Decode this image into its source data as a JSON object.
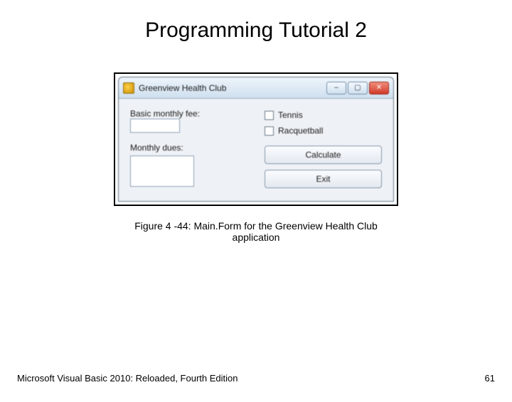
{
  "slide": {
    "title": "Programming Tutorial 2",
    "caption": "Figure 4 -44: Main.Form for the Greenview Health Club application",
    "footer_left": "Microsoft Visual Basic 2010: Reloaded, Fourth Edition",
    "page_number": "61"
  },
  "window": {
    "title": "Greenview Health Club",
    "labels": {
      "basic_fee": "Basic monthly fee:",
      "monthly_dues": "Monthly dues:"
    },
    "checkboxes": {
      "tennis": "Tennis",
      "racquetball": "Racquetball"
    },
    "buttons": {
      "calculate": "Calculate",
      "exit": "Exit"
    },
    "sysbuttons": {
      "min": "–",
      "max": "▢",
      "close": "✕"
    }
  }
}
